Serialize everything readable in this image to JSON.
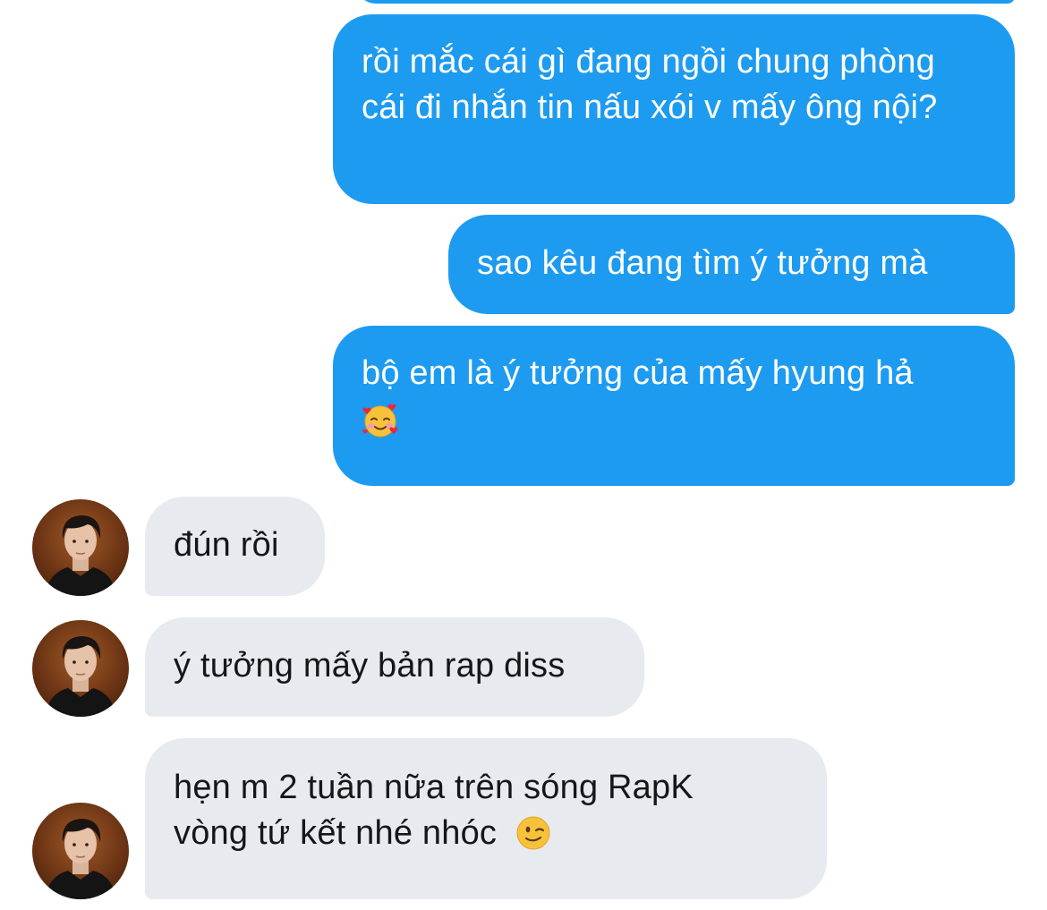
{
  "conversation": {
    "messages": [
      {
        "direction": "outgoing",
        "text": "rồi mắc cái gì đang ngồi chung phòng cái đi nhắn tin nấu xói v mấy ông nội?"
      },
      {
        "direction": "outgoing",
        "text": "sao kêu đang tìm ý tưởng mà"
      },
      {
        "direction": "outgoing",
        "text": "bộ em là ý tưởng của mấy hyung hả",
        "emoji": "smiling-face-with-hearts-emoji"
      },
      {
        "direction": "incoming",
        "text": "đún rồi"
      },
      {
        "direction": "incoming",
        "text": "ý tưởng mấy bản rap diss"
      },
      {
        "direction": "incoming",
        "text": "hẹn m 2 tuần nữa trên sóng RapK vòng tứ kết nhé nhóc",
        "emoji": "winking-face-emoji"
      }
    ]
  },
  "colors": {
    "outgoing_bubble": "#1d9bf0",
    "incoming_bubble": "#e7ebef",
    "incoming_text": "#14171a",
    "avatar_background": "#6d3515"
  }
}
